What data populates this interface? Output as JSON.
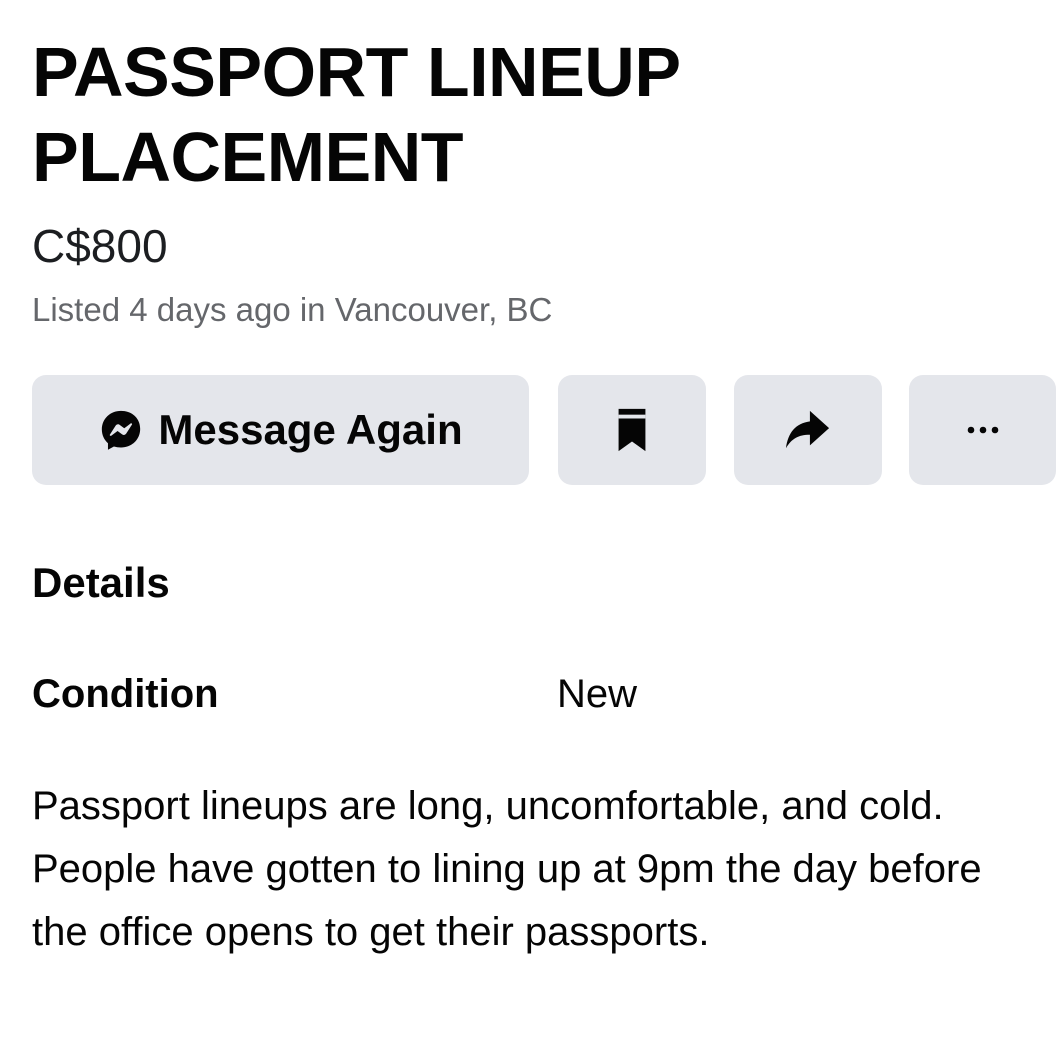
{
  "listing": {
    "title": "PASSPORT LINEUP PLACEMENT",
    "price": "C$800",
    "meta": "Listed 4 days ago in Vancouver, BC"
  },
  "actions": {
    "message_label": "Message Again",
    "icons": [
      "messenger-icon",
      "bookmark-icon",
      "share-icon",
      "more-icon"
    ]
  },
  "details": {
    "heading": "Details",
    "condition_label": "Condition",
    "condition_value": "New",
    "description": "Passport lineups are long, uncomfortable, and cold. People have gotten to lining up at 9pm the day before the office opens to get their passports."
  },
  "colors": {
    "button_bg": "#e4e6eb",
    "text_primary": "#050505",
    "text_secondary": "#65676b"
  }
}
